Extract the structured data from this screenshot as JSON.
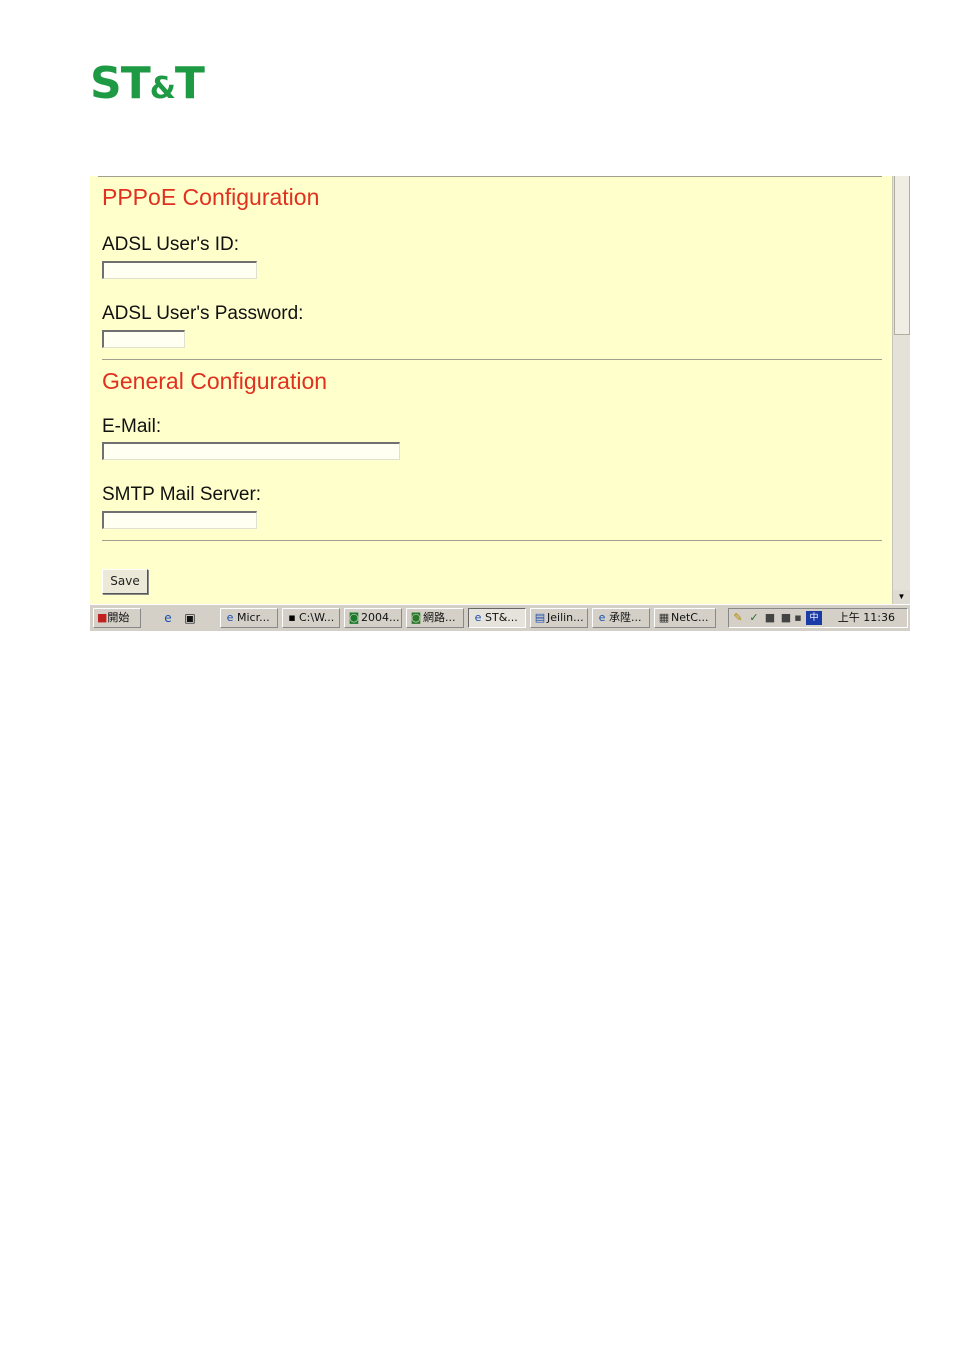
{
  "logo": {
    "prefix": "ST",
    "amp": "&",
    "suffix": "T"
  },
  "pppoe": {
    "title": "PPPoE Configuration",
    "user_id_label": "ADSL User's ID:",
    "user_id_value": "",
    "password_label": "ADSL User's Password:",
    "password_value": ""
  },
  "general": {
    "title": "General Configuration",
    "email_label": "E-Mail:",
    "email_value": "",
    "smtp_label": "SMTP Mail Server:",
    "smtp_value": ""
  },
  "save_label": "Save",
  "taskbar": {
    "start_label": "開始",
    "buttons": [
      {
        "label": "Micr..."
      },
      {
        "label": "C:\\W..."
      },
      {
        "label": "2004..."
      },
      {
        "label": "網路..."
      },
      {
        "label": "ST&..."
      },
      {
        "label": "Jeilin..."
      },
      {
        "label": "承陞..."
      },
      {
        "label": "NetC..."
      }
    ],
    "ime_label": "中",
    "clock": "上午 11:36"
  }
}
